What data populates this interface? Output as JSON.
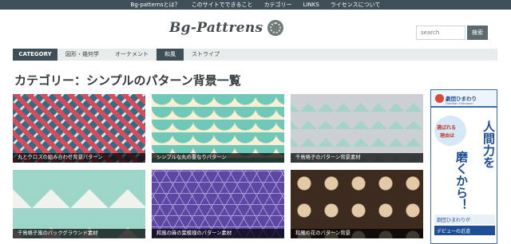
{
  "topnav": [
    {
      "label": "Bg-patternsとは？"
    },
    {
      "label": "このサイトでできること"
    },
    {
      "label": "カテゴリー"
    },
    {
      "label": "LINKS"
    },
    {
      "label": "ライセンスについて"
    }
  ],
  "header": {
    "logo": "Bg-Pattrens",
    "search_placeholder": "search",
    "search_button": "検索"
  },
  "nav": {
    "category_label": "CATEGORY",
    "items": [
      {
        "label": "図形・幾何学",
        "active": false
      },
      {
        "label": "オーナメント",
        "active": false
      },
      {
        "label": "和風",
        "active": true
      },
      {
        "label": "ストライプ",
        "active": false
      }
    ]
  },
  "page_title": "カテゴリー：シンプルのパターン背景一覧",
  "cards": [
    {
      "caption": "丸とクロスの組み合わせ背景パターン",
      "colors": [
        "#2c6f8a",
        "#d94a5a",
        "#e3dfd6"
      ]
    },
    {
      "caption": "シンプルな丸の重なりパターン",
      "colors": [
        "#fbeed2",
        "#6fc8b8"
      ]
    },
    {
      "caption": "千鳥格子のパターン背景素材",
      "colors": [
        "#cdd0d2",
        "#a4d3c9"
      ]
    },
    {
      "caption": "千鳥格子風のバックグラウンド素材",
      "colors": [
        "#9bd6c9",
        "#f0f2ee"
      ]
    },
    {
      "caption": "和風の麻の葉模様のパターン素材",
      "colors": [
        "#5c47a3",
        "#a797d4"
      ]
    },
    {
      "caption": "和風の花のパターン背景",
      "colors": [
        "#3d2b20",
        "#e3c9a6"
      ]
    }
  ],
  "ad": {
    "brand": "劇団ひまわり",
    "brand_sub": "Gekidan Himawari",
    "question_line1": "選ばれる",
    "question_line2": "理由は",
    "vertical_line1": "人間力を",
    "vertical_line2": "磨くから！",
    "bottom_line1": "劇団ひまわりが",
    "bottom_line2": "デビューの近道"
  },
  "colors": {
    "dark_bar": "#3e4f57",
    "nav_bg": "#e9ecec",
    "ad_blue": "#1f4e96"
  }
}
